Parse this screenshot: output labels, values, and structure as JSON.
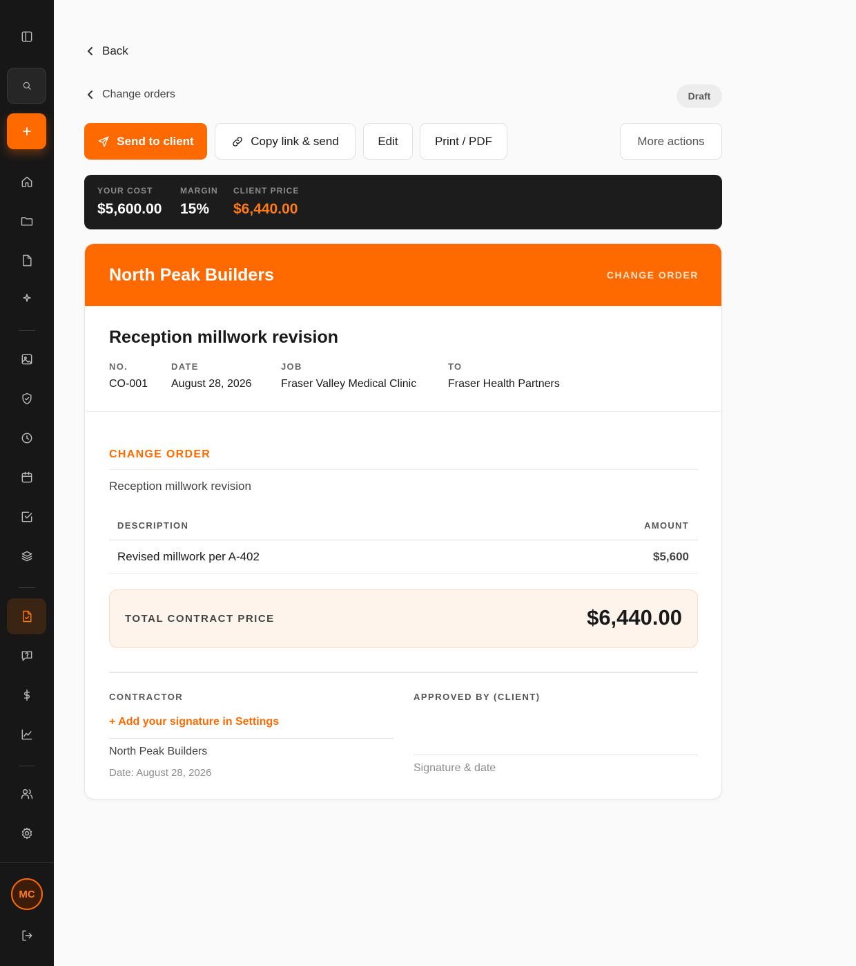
{
  "nav": {
    "back_label": "Back",
    "breadcrumb_label": "Change orders",
    "status_badge": "Draft"
  },
  "toolbar": {
    "send_label": "Send to client",
    "copy_label": "Copy link & send",
    "edit_label": "Edit",
    "print_label": "Print / PDF",
    "more_label": "More actions"
  },
  "summary": {
    "cost_label": "YOUR COST",
    "cost_value": "$5,600.00",
    "margin_label": "MARGIN",
    "margin_value": "15%",
    "price_label": "CLIENT PRICE",
    "price_value": "$6,440.00"
  },
  "document": {
    "company_name": "North Peak Builders",
    "doc_type": "CHANGE ORDER",
    "title": "Reception millwork revision",
    "meta": {
      "no_label": "NO.",
      "no_value": "CO-001",
      "date_label": "DATE",
      "date_value": "August 28, 2026",
      "job_label": "JOB",
      "job_value": "Fraser Valley Medical Clinic",
      "to_label": "TO",
      "to_value": "Fraser Health Partners"
    },
    "section_title": "CHANGE ORDER",
    "section_description": "Reception millwork revision",
    "table": {
      "col_description": "DESCRIPTION",
      "col_amount": "AMOUNT",
      "rows": [
        {
          "description": "Revised millwork per A-402",
          "amount": "$5,600"
        }
      ]
    },
    "total_label": "TOTAL CONTRACT PRICE",
    "total_value": "$6,440.00",
    "signatures": {
      "contractor_label": "CONTRACTOR",
      "add_signature_link": "+ Add your signature in Settings",
      "contractor_name": "North Peak Builders",
      "contractor_date": "Date: August 28, 2026",
      "client_label": "APPROVED BY (CLIENT)",
      "client_line_label": "Signature & date"
    }
  },
  "user": {
    "initials": "MC"
  },
  "colors": {
    "accent": "#ff6a00",
    "sidebar": "#171717",
    "summary_bg": "#1c1c1c",
    "total_bg": "#fff4ec"
  },
  "icons": {
    "sidebar": [
      "sidebar-toggle-icon",
      "search-icon",
      "plus-icon",
      "home-icon",
      "folder-icon",
      "file-icon",
      "sparkle-icon",
      "image-icon",
      "shield-check-icon",
      "clock-icon",
      "calendar-icon",
      "checkbox-icon",
      "layers-icon",
      "file-check-icon",
      "message-question-icon",
      "dollar-icon",
      "chart-line-icon",
      "users-icon",
      "gear-icon",
      "logout-icon"
    ],
    "toolbar": [
      "send-icon",
      "link-icon"
    ]
  }
}
